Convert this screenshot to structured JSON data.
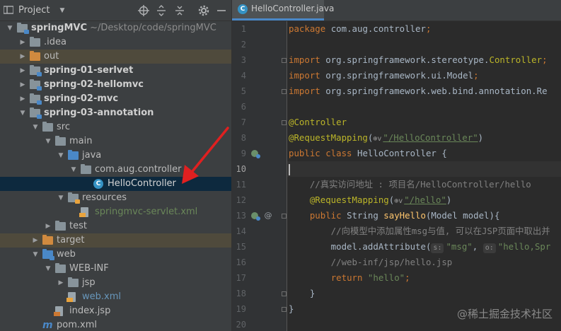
{
  "project_panel": {
    "title": "Project",
    "toolbar_icons": [
      "locate-icon",
      "expand-all-icon",
      "collapse-all-icon",
      "settings-icon",
      "hide-icon"
    ],
    "tree": [
      {
        "label": "springMVC",
        "path": "~/Desktop/code/springMVC",
        "level": 0,
        "expanded": true,
        "bold": true,
        "icon": "module-folder-icon"
      },
      {
        "label": ".idea",
        "level": 1,
        "expanded": false,
        "icon": "folder-icon"
      },
      {
        "label": "out",
        "level": 1,
        "expanded": false,
        "icon": "excluded-folder-icon",
        "excluded": true
      },
      {
        "label": "spring-01-serlvet",
        "level": 1,
        "expanded": false,
        "bold": true,
        "icon": "module-folder-icon"
      },
      {
        "label": "spring-02-hellomvc",
        "level": 1,
        "expanded": false,
        "bold": true,
        "icon": "module-folder-icon"
      },
      {
        "label": "spring-02-mvc",
        "level": 1,
        "expanded": false,
        "bold": true,
        "icon": "module-folder-icon"
      },
      {
        "label": "spring-03-annotation",
        "level": 1,
        "expanded": true,
        "bold": true,
        "icon": "module-folder-icon"
      },
      {
        "label": "src",
        "level": 2,
        "expanded": true,
        "icon": "folder-icon"
      },
      {
        "label": "main",
        "level": 3,
        "expanded": true,
        "icon": "folder-icon"
      },
      {
        "label": "java",
        "level": 4,
        "expanded": true,
        "icon": "source-folder-icon"
      },
      {
        "label": "com.aug.controller",
        "level": 5,
        "expanded": true,
        "icon": "package-icon"
      },
      {
        "label": "HelloController",
        "level": 6,
        "icon": "java-class-icon",
        "selected": true
      },
      {
        "label": "resources",
        "level": 4,
        "expanded": true,
        "icon": "resources-folder-icon"
      },
      {
        "label": "springmvc-servlet.xml",
        "level": 5,
        "icon": "xml-file-icon",
        "color": "#6a8759"
      },
      {
        "label": "test",
        "level": 3,
        "expanded": false,
        "icon": "folder-icon"
      },
      {
        "label": "target",
        "level": 2,
        "expanded": false,
        "icon": "excluded-folder-icon",
        "excluded": true
      },
      {
        "label": "web",
        "level": 2,
        "expanded": true,
        "icon": "web-folder-icon"
      },
      {
        "label": "WEB-INF",
        "level": 3,
        "expanded": true,
        "icon": "folder-icon"
      },
      {
        "label": "jsp",
        "level": 4,
        "expanded": false,
        "icon": "folder-icon"
      },
      {
        "label": "web.xml",
        "level": 4,
        "icon": "xml-file-icon",
        "color": "#6897bb"
      },
      {
        "label": "index.jsp",
        "level": 3,
        "icon": "jsp-file-icon"
      },
      {
        "label": "pom.xml",
        "level": 2,
        "icon": "maven-icon"
      }
    ]
  },
  "editor": {
    "tab_label": "HelloController.java",
    "current_line": 10,
    "lines": [
      {
        "n": "1",
        "segs": [
          [
            "kw",
            "package "
          ],
          [
            "",
            "com.aug.controller"
          ],
          [
            "kw",
            ";"
          ]
        ]
      },
      {
        "n": "2",
        "segs": []
      },
      {
        "n": "3",
        "segs": [
          [
            "kw",
            "import "
          ],
          [
            "",
            "org.springframework.stereotype."
          ],
          [
            "ann",
            "Controller"
          ],
          [
            "kw",
            ";"
          ]
        ],
        "fold": true
      },
      {
        "n": "4",
        "segs": [
          [
            "kw",
            "import "
          ],
          [
            "",
            "org.springframework.ui.Model"
          ],
          [
            "kw",
            ";"
          ]
        ]
      },
      {
        "n": "5",
        "segs": [
          [
            "kw",
            "import "
          ],
          [
            "",
            "org.springframework.web.bind.annotation.Re"
          ]
        ],
        "fold": true
      },
      {
        "n": "6",
        "segs": []
      },
      {
        "n": "7",
        "segs": [
          [
            "ann",
            "@Controller"
          ]
        ],
        "fold": true
      },
      {
        "n": "8",
        "segs": [
          [
            "ann",
            "@RequestMapping"
          ],
          [
            "",
            "("
          ],
          [
            "globe",
            "⊕v"
          ],
          [
            "link",
            "\"/HelloController\""
          ],
          [
            "",
            ")"
          ]
        ]
      },
      {
        "n": "9",
        "segs": [
          [
            "kw",
            "public class "
          ],
          [
            "",
            "HelloController {"
          ]
        ],
        "gutter_icon": "bean-icon"
      },
      {
        "n": "10",
        "segs": [
          [
            "",
            "|"
          ]
        ]
      },
      {
        "n": "11",
        "segs": [
          [
            "cmt",
            "    //真实访问地址 : 项目名/HelloController/hello"
          ]
        ]
      },
      {
        "n": "12",
        "segs": [
          [
            "",
            "    "
          ],
          [
            "ann",
            "@RequestMapping"
          ],
          [
            "",
            "("
          ],
          [
            "globe",
            "⊕v"
          ],
          [
            "link",
            "\"/hello\""
          ],
          [
            "",
            ")"
          ]
        ]
      },
      {
        "n": "13",
        "segs": [
          [
            "",
            "    "
          ],
          [
            "kw",
            "public "
          ],
          [
            "",
            "String "
          ],
          [
            "meth",
            "sayHello"
          ],
          [
            "",
            "(Model model){"
          ]
        ],
        "gutter_icon": "bean-icon",
        "gutter_icon2": "at-icon",
        "fold": true
      },
      {
        "n": "14",
        "segs": [
          [
            "cmt",
            "        //向模型中添加属性msg与值, 可以在JSP页面中取出并"
          ]
        ]
      },
      {
        "n": "15",
        "segs": [
          [
            "",
            "        model.addAttribute("
          ],
          [
            "hint",
            "s:"
          ],
          [
            "str",
            "\"msg\""
          ],
          [
            "",
            ", "
          ],
          [
            "hint",
            "o:"
          ],
          [
            "str",
            "\"hello,Spr"
          ]
        ]
      },
      {
        "n": "16",
        "segs": [
          [
            "cmt",
            "        //web-inf/jsp/hello.jsp"
          ]
        ]
      },
      {
        "n": "17",
        "segs": [
          [
            "",
            "        "
          ],
          [
            "kw",
            "return "
          ],
          [
            "str",
            "\"hello\""
          ],
          [
            "kw",
            ";"
          ]
        ]
      },
      {
        "n": "18",
        "segs": [
          [
            "",
            "    }"
          ]
        ],
        "fold": true
      },
      {
        "n": "19",
        "segs": [
          [
            "",
            "}"
          ]
        ],
        "fold": true
      },
      {
        "n": "20",
        "segs": []
      }
    ]
  },
  "watermark": "@稀土掘金技术社区",
  "colors": {
    "accent": "#4a88c7",
    "selection": "#0d293e",
    "annotation_arrow": "#e02020"
  }
}
